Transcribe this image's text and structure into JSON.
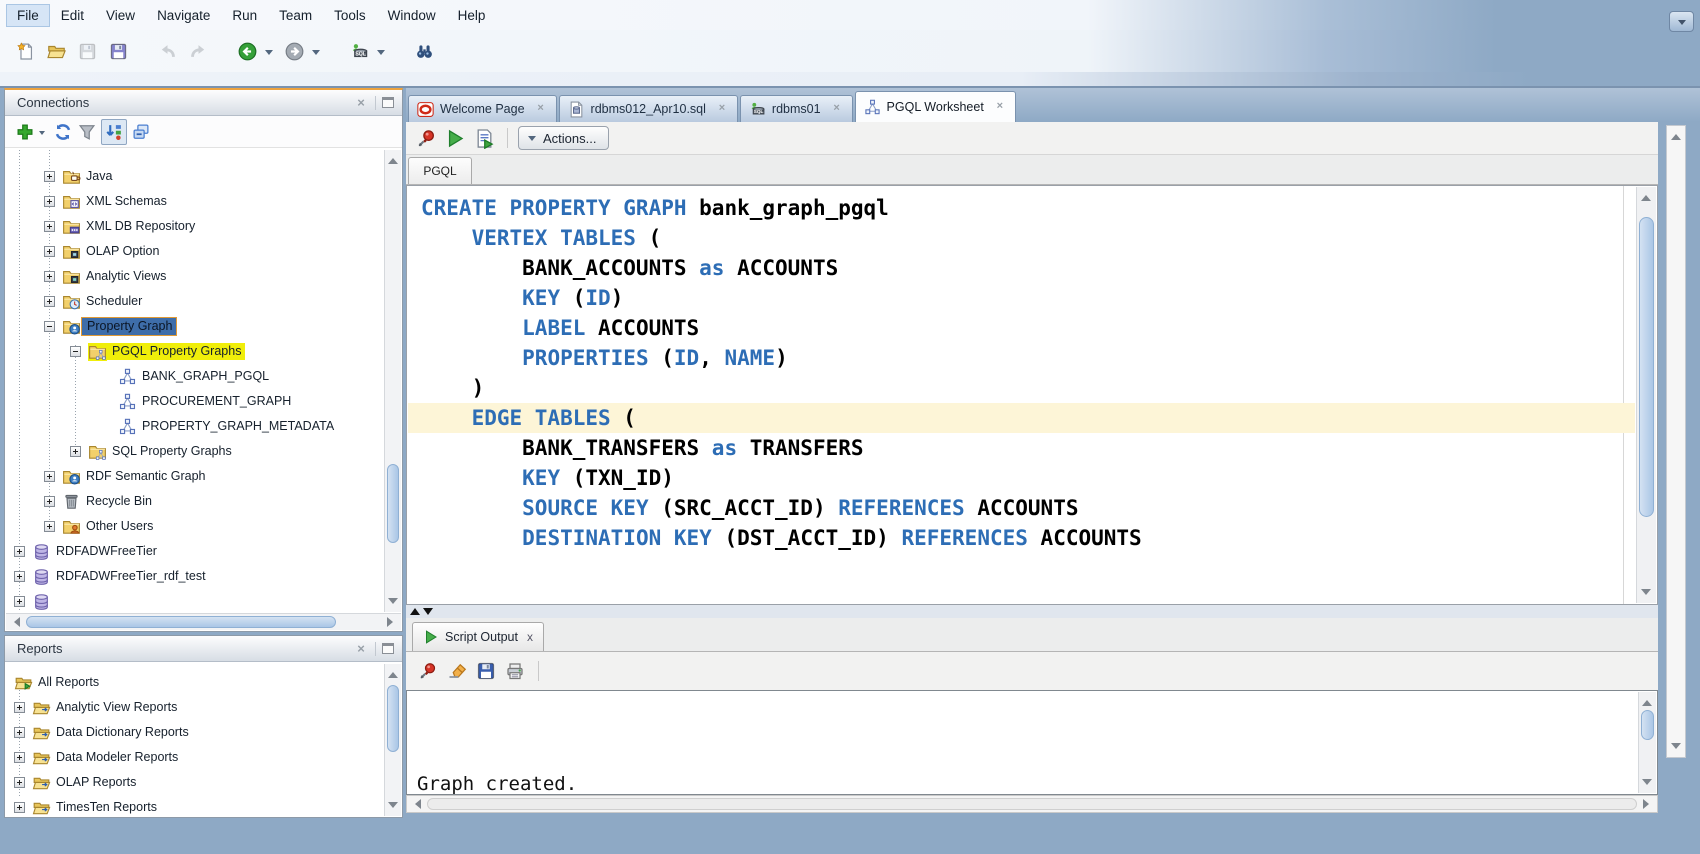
{
  "window": {
    "desktop_color": "#8ea9c5",
    "app": "Oracle SQL Developer"
  },
  "menu": {
    "items": [
      "File",
      "Edit",
      "View",
      "Navigate",
      "Run",
      "Team",
      "Tools",
      "Window",
      "Help"
    ]
  },
  "main_toolbar": {
    "icons": [
      "new-file",
      "open-folder",
      "save",
      "save-all",
      "undo",
      "redo",
      "back",
      "forward",
      "sql-worksheet",
      "search"
    ]
  },
  "connections": {
    "title": "Connections",
    "toolbar_icons": [
      "add-connection",
      "refresh",
      "apply-filter",
      "sort",
      "collapse-all"
    ],
    "tree": [
      {
        "label": "Java",
        "icon": "java-folder"
      },
      {
        "label": "XML Schemas",
        "icon": "xml-schemas-folder"
      },
      {
        "label": "XML DB Repository",
        "icon": "xml-db-folder"
      },
      {
        "label": "OLAP Option",
        "icon": "olap-folder"
      },
      {
        "label": "Analytic Views",
        "icon": "analytic-views-folder"
      },
      {
        "label": "Scheduler",
        "icon": "scheduler-folder"
      },
      {
        "label": "Property Graph",
        "icon": "property-graph-folder",
        "selected": true
      },
      {
        "label": "PGQL Property Graphs",
        "icon": "pgql-graphs-folder",
        "highlighted": true
      },
      {
        "label": "BANK_GRAPH_PGQL",
        "icon": "graph"
      },
      {
        "label": "PROCUREMENT_GRAPH",
        "icon": "graph"
      },
      {
        "label": "PROPERTY_GRAPH_METADATA",
        "icon": "graph"
      },
      {
        "label": "SQL Property Graphs",
        "icon": "sql-graphs-folder"
      },
      {
        "label": "RDF Semantic Graph",
        "icon": "rdf-folder"
      },
      {
        "label": "Recycle Bin",
        "icon": "trash"
      },
      {
        "label": "Other Users",
        "icon": "users-folder"
      },
      {
        "label": "RDFADWFreeTier",
        "icon": "database"
      },
      {
        "label": "RDFADWFreeTier_rdf_test",
        "icon": "database"
      },
      {
        "label": "",
        "icon": "database"
      }
    ]
  },
  "reports": {
    "title": "Reports",
    "tree": [
      {
        "label": "All Reports",
        "icon": "all-reports"
      },
      {
        "label": "Analytic View Reports",
        "icon": "report-folder"
      },
      {
        "label": "Data Dictionary Reports",
        "icon": "report-folder"
      },
      {
        "label": "Data Modeler Reports",
        "icon": "report-folder"
      },
      {
        "label": "OLAP Reports",
        "icon": "report-folder"
      },
      {
        "label": "TimesTen Reports",
        "icon": "report-folder"
      }
    ]
  },
  "editor_tabs": [
    {
      "label": "Welcome Page",
      "icon": "oracle-logo"
    },
    {
      "label": "rdbms012_Apr10.sql",
      "icon": "sql-file"
    },
    {
      "label": "rdbms01",
      "icon": "sql-connection"
    },
    {
      "label": "PGQL Worksheet",
      "icon": "property-graph",
      "active": true
    }
  ],
  "worksheet": {
    "toolbar_icons": [
      "pin",
      "run",
      "run-script"
    ],
    "actions_label": "Actions...",
    "doc_tab": "PGQL"
  },
  "code": {
    "current_line_index": 7,
    "lines": [
      {
        "segs": [
          {
            "t": "CREATE PROPERTY GRAPH",
            "k": 1
          },
          {
            "t": " bank_graph_pgql",
            "k": 0
          }
        ]
      },
      {
        "segs": [
          {
            "t": "    ",
            "k": 0
          },
          {
            "t": "VERTEX TABLES",
            "k": 1
          },
          {
            "t": " (",
            "k": 0
          }
        ]
      },
      {
        "segs": [
          {
            "t": "        BANK_ACCOUNTS ",
            "k": 0
          },
          {
            "t": "as",
            "k": 1
          },
          {
            "t": " ACCOUNTS",
            "k": 0
          }
        ]
      },
      {
        "segs": [
          {
            "t": "        ",
            "k": 0
          },
          {
            "t": "KEY",
            "k": 1
          },
          {
            "t": " (",
            "k": 0
          },
          {
            "t": "ID",
            "k": 1
          },
          {
            "t": ")",
            "k": 0
          }
        ]
      },
      {
        "segs": [
          {
            "t": "        ",
            "k": 0
          },
          {
            "t": "LABEL",
            "k": 1
          },
          {
            "t": " ACCOUNTS",
            "k": 0
          }
        ]
      },
      {
        "segs": [
          {
            "t": "        ",
            "k": 0
          },
          {
            "t": "PROPERTIES",
            "k": 1
          },
          {
            "t": " (",
            "k": 0
          },
          {
            "t": "ID",
            "k": 1
          },
          {
            "t": ", ",
            "k": 0
          },
          {
            "t": "NAME",
            "k": 1
          },
          {
            "t": ")",
            "k": 0
          }
        ]
      },
      {
        "segs": [
          {
            "t": "    )",
            "k": 0
          }
        ]
      },
      {
        "segs": [
          {
            "t": "    ",
            "k": 0
          },
          {
            "t": "EDGE TABLES",
            "k": 1
          },
          {
            "t": " (",
            "k": 0
          }
        ]
      },
      {
        "segs": [
          {
            "t": "        BANK_TRANSFERS ",
            "k": 0
          },
          {
            "t": "as",
            "k": 1
          },
          {
            "t": " TRANSFERS",
            "k": 0
          }
        ]
      },
      {
        "segs": [
          {
            "t": "        ",
            "k": 0
          },
          {
            "t": "KEY",
            "k": 1
          },
          {
            "t": " (TXN_ID)",
            "k": 0
          }
        ]
      },
      {
        "segs": [
          {
            "t": "        ",
            "k": 0
          },
          {
            "t": "SOURCE KEY",
            "k": 1
          },
          {
            "t": " (SRC_ACCT_ID) ",
            "k": 0
          },
          {
            "t": "REFERENCES",
            "k": 1
          },
          {
            "t": " ACCOUNTS",
            "k": 0
          }
        ]
      },
      {
        "segs": [
          {
            "t": "        ",
            "k": 0
          },
          {
            "t": "DESTINATION KEY",
            "k": 1
          },
          {
            "t": " (DST_ACCT_ID) ",
            "k": 0
          },
          {
            "t": "REFERENCES",
            "k": 1
          },
          {
            "t": " ACCOUNTS",
            "k": 0
          }
        ]
      }
    ]
  },
  "script_output": {
    "tab_label": "Script Output",
    "toolbar_icons": [
      "pin",
      "clear",
      "save",
      "print"
    ],
    "text": "Graph created."
  },
  "colors": {
    "keyword": "#2d6db5",
    "plain": "#000000",
    "current_line": "#fdf5d7",
    "selection_bg": "#3e6da9",
    "selection_border": "#e09a36",
    "highlight_yellow": "#f0ee0a",
    "desktop": "#8ea9c5",
    "run_green": "#46ad4a"
  }
}
